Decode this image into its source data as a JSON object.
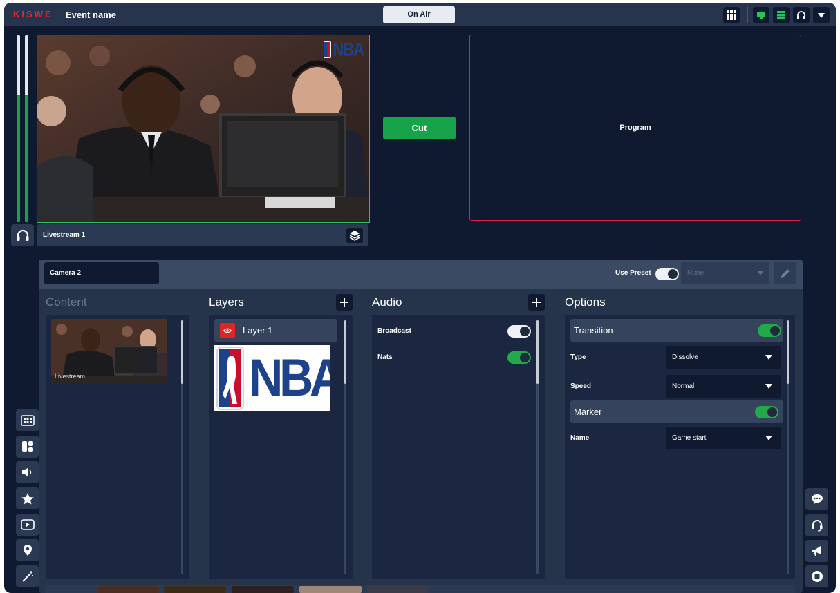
{
  "app": {
    "brand": "KISWE",
    "event_name": "Event name",
    "status_button": "On Air"
  },
  "colors": {
    "accent_green": "#16a34a",
    "program_red": "#e11d48",
    "brand_red": "#e8262f",
    "background": "#0f1930"
  },
  "top_right_icons": [
    "grid-icon",
    "monitor-icon",
    "layout-icon",
    "headset-icon",
    "dropdown-icon"
  ],
  "preview": {
    "source_label": "Livestream 1",
    "watermark": "NBA"
  },
  "audio_meters": [
    {
      "level": 0.68
    },
    {
      "level": 0.68
    }
  ],
  "transition": {
    "cut_label": "Cut"
  },
  "program": {
    "label": "Program"
  },
  "panel": {
    "camera_name": "Camera 2",
    "use_preset_label": "Use Preset",
    "use_preset_on": true,
    "preset_value": "None",
    "content": {
      "title": "Content",
      "items": [
        {
          "label": "Livestream"
        }
      ]
    },
    "layers": {
      "title": "Layers",
      "items": [
        {
          "label": "Layer 1",
          "visible": true
        }
      ],
      "graphic": "NBA"
    },
    "audio": {
      "title": "Audio",
      "channels": [
        {
          "label": "Broadcast",
          "on": true
        },
        {
          "label": "Nats",
          "on": true
        }
      ]
    },
    "options": {
      "title": "Options",
      "transition": {
        "label": "Transition",
        "enabled": true,
        "type_label": "Type",
        "type_value": "Dissolve",
        "speed_label": "Speed",
        "speed_value": "Normal"
      },
      "marker": {
        "label": "Marker",
        "enabled": true,
        "name_label": "Name",
        "name_value": "Game start"
      }
    }
  },
  "left_tools": [
    "multiview-icon",
    "layout-icon",
    "speaker-icon",
    "star-icon",
    "play-icon",
    "location-pin-icon",
    "magic-wand-icon"
  ],
  "right_tools": [
    "chat-icon",
    "headset-icon",
    "megaphone-icon",
    "record-icon"
  ]
}
